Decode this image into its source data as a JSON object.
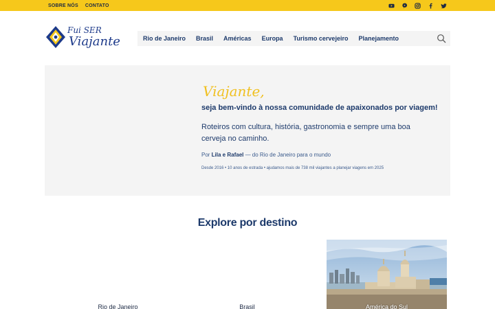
{
  "topbar": {
    "links": [
      "SOBRE NÓS",
      "CONTATO"
    ],
    "social_icons": [
      "youtube-icon",
      "pinterest-icon",
      "instagram-icon",
      "facebook-icon",
      "twitter-icon"
    ],
    "color": "#f6c81b"
  },
  "brand": {
    "line1": "Fui SER",
    "line2": "Viajante"
  },
  "nav": {
    "items": [
      "Rio de Janeiro",
      "Brasil",
      "Américas",
      "Europa",
      "Turismo cervejeiro",
      "Planejamento"
    ],
    "search_icon": "search-icon"
  },
  "hero": {
    "script": "Viajante,",
    "welcome": "seja bem-vindo à nossa comunidade de apaixonados por viagem!",
    "lead": "Roteiros com cultura, história, gastronomia e sempre uma boa cerveja no caminho.",
    "by_prefix": "Por ",
    "by_names": "Lila e Rafael",
    "by_suffix": " — do Rio de Janeiro para o mundo",
    "since": "Desde 2016 • 10 anos de estrada • ajudamos mais de 738 mil viajantes a planejar viagens em 2025"
  },
  "explore": {
    "title": "Explore por destino",
    "cards": [
      {
        "label": "Rio de Janeiro"
      },
      {
        "label": "Brasil"
      },
      {
        "label": "América do Sul"
      }
    ]
  },
  "colors": {
    "primary": "#1d3a6b",
    "accent": "#f0c020",
    "hero_bg": "#f4f4f4"
  }
}
